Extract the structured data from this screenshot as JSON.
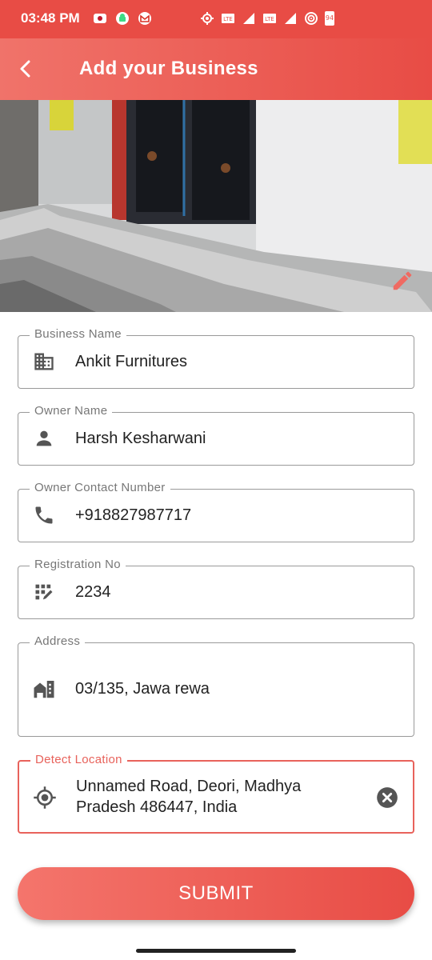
{
  "status_bar": {
    "time": "03:48 PM",
    "battery": "94",
    "left_icons": [
      "notification-icon",
      "android-icon",
      "gmail-icon"
    ],
    "right_icons": [
      "location-icon",
      "volte-icon",
      "signal-icon",
      "volte-icon",
      "signal-icon",
      "hotspot-icon",
      "battery-icon"
    ]
  },
  "app_bar": {
    "title": "Add your Business",
    "back_icon": "back-arrow-icon"
  },
  "hero": {
    "edit_icon": "pencil-icon"
  },
  "form": {
    "business_name": {
      "label": "Business Name",
      "value": "Ankit Furnitures",
      "icon": "building-icon"
    },
    "owner_name": {
      "label": "Owner Name",
      "value": "Harsh Kesharwani",
      "icon": "person-icon"
    },
    "owner_contact": {
      "label": "Owner Contact Number",
      "value": "+918827987717",
      "icon": "phone-icon"
    },
    "registration_no": {
      "label": "Registration No",
      "value": "2234",
      "icon": "registration-icon"
    },
    "address": {
      "label": "Address",
      "value": "03/135, Jawa rewa",
      "icon": "home-icon"
    },
    "location": {
      "label": "Detect Location",
      "value_line1": "Unnamed Road, Deori, Madhya",
      "value_line2": "Pradesh 486447, India",
      "icon": "gps-icon",
      "clear_icon": "clear-icon"
    }
  },
  "submit": {
    "label": "SUBMIT"
  },
  "colors": {
    "accent": "#e84c45",
    "accent_light": "#f0736a",
    "field_border": "#9a9a9a"
  }
}
